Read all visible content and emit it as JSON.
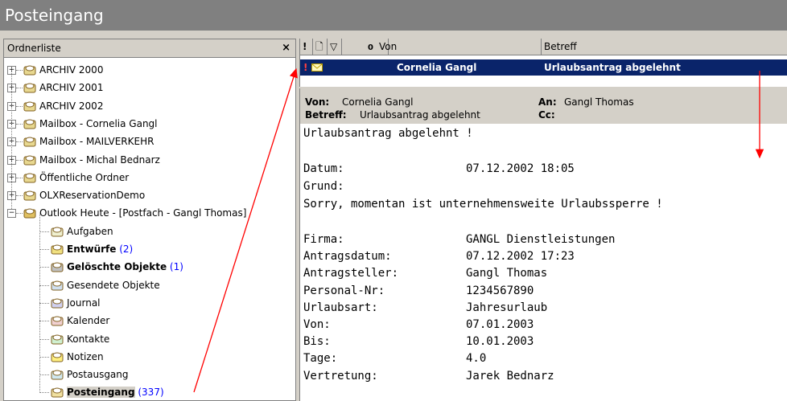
{
  "window": {
    "title": "Posteingang"
  },
  "folder_pane": {
    "header": "Ordnerliste",
    "close": "×",
    "items": [
      {
        "label": "ARCHIV 2000",
        "count": "",
        "bold": false,
        "icon": "mailbox-icon"
      },
      {
        "label": "ARCHIV 2001",
        "count": "",
        "bold": false,
        "icon": "mailbox-icon"
      },
      {
        "label": "ARCHIV 2002",
        "count": "",
        "bold": false,
        "icon": "mailbox-icon"
      },
      {
        "label": "Mailbox - Cornelia Gangl",
        "count": "",
        "bold": false,
        "icon": "mailbox-icon"
      },
      {
        "label": "Mailbox - MAILVERKEHR",
        "count": "",
        "bold": false,
        "icon": "mailbox-icon"
      },
      {
        "label": "Mailbox - Michal Bednarz",
        "count": "",
        "bold": false,
        "icon": "mailbox-icon"
      },
      {
        "label": "Öffentliche Ordner",
        "count": "",
        "bold": false,
        "icon": "mailbox-icon"
      },
      {
        "label": "OLXReservationDemo",
        "count": "",
        "bold": false,
        "icon": "mailbox-icon"
      },
      {
        "label": "Outlook Heute - [Postfach - Gangl Thomas]",
        "count": "",
        "bold": false,
        "icon": "outlook-today-icon"
      },
      {
        "label": "Aufgaben",
        "count": "",
        "bold": false,
        "icon": "tasks-icon"
      },
      {
        "label": "Entwürfe",
        "count": "(2)",
        "bold": true,
        "icon": "drafts-icon"
      },
      {
        "label": "Gelöschte Objekte",
        "count": "(1)",
        "bold": true,
        "icon": "deleted-items-icon"
      },
      {
        "label": "Gesendete Objekte",
        "count": "",
        "bold": false,
        "icon": "sent-items-icon"
      },
      {
        "label": "Journal",
        "count": "",
        "bold": false,
        "icon": "journal-icon"
      },
      {
        "label": "Kalender",
        "count": "",
        "bold": false,
        "icon": "calendar-icon"
      },
      {
        "label": "Kontakte",
        "count": "",
        "bold": false,
        "icon": "contacts-icon"
      },
      {
        "label": "Notizen",
        "count": "",
        "bold": false,
        "icon": "notes-icon"
      },
      {
        "label": "Postausgang",
        "count": "",
        "bold": false,
        "icon": "outbox-icon"
      },
      {
        "label": "Posteingang",
        "count": "(337)",
        "bold": true,
        "icon": "inbox-icon"
      }
    ]
  },
  "message_list": {
    "columns": {
      "importance": "!",
      "type": "🗋",
      "flag": "▽",
      "attach": "0",
      "from": "Von",
      "subject": "Betreff"
    },
    "rows": [
      {
        "from": "Cornelia Gangl",
        "subject": "Urlaubsantrag abgelehnt",
        "importance_icon": "high-importance-icon",
        "type_icon": "envelope-icon"
      }
    ]
  },
  "preview": {
    "from_label": "Von:",
    "from": "Cornelia Gangl",
    "to_label": "An:",
    "to": "Gangl Thomas",
    "subject_label": "Betreff:",
    "subject": "Urlaubsantrag abgelehnt",
    "cc_label": "Cc:",
    "body_title": "Urlaubsantrag abgelehnt !",
    "date_label": "Datum:",
    "date": "07.12.2002 18:05",
    "reason_label": "Grund:",
    "reason": "Sorry, momentan ist unternehmensweite Urlaubssperre !",
    "fields": [
      {
        "label": "Firma:",
        "value": "GANGL Dienstleistungen"
      },
      {
        "label": "Antragsdatum:",
        "value": "07.12.2002 17:23"
      },
      {
        "label": "Antragsteller:",
        "value": "Gangl Thomas"
      },
      {
        "label": "Personal-Nr:",
        "value": "1234567890"
      },
      {
        "label": "Urlaubsart:",
        "value": "Jahresurlaub"
      },
      {
        "label": "Von:",
        "value": "07.01.2003"
      },
      {
        "label": "Bis:",
        "value": "10.01.2003"
      },
      {
        "label": "Tage:",
        "value": "4.0"
      },
      {
        "label": "Vertretung:",
        "value": "Jarek Bednarz"
      }
    ]
  },
  "colors": {
    "selection": "#0a246a",
    "count": "#0000ff",
    "arrow": "#ff0000",
    "title_bg": "#808080"
  }
}
